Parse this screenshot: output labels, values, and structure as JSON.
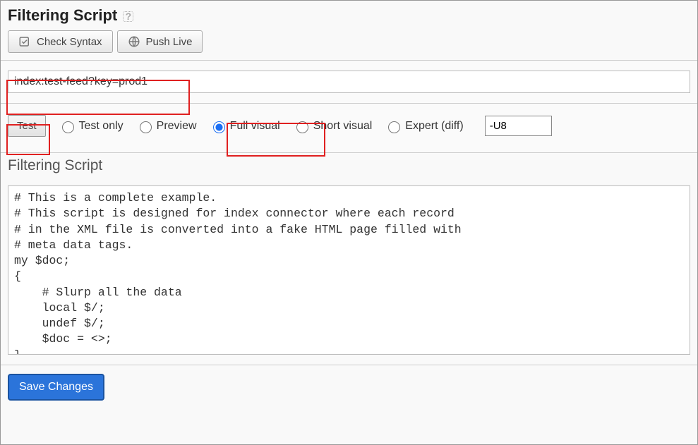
{
  "header": {
    "title": "Filtering Script",
    "check_syntax_label": "Check Syntax",
    "push_live_label": "Push Live"
  },
  "url_field": {
    "value": "index:test-feed?key=prod1"
  },
  "test_controls": {
    "test_button_label": "Test",
    "options": {
      "test_only": "Test only",
      "preview": "Preview",
      "full_visual": "Full visual",
      "short_visual": "Short visual",
      "expert_diff": "Expert (diff)"
    },
    "selected": "full_visual",
    "diff_value": "-U8"
  },
  "editor": {
    "heading": "Filtering Script",
    "content": "# This is a complete example.\n# This script is designed for index connector where each record\n# in the XML file is converted into a fake HTML page filled with\n# meta data tags.\nmy $doc;\n{\n    # Slurp all the data\n    local $/;\n    undef $/;\n    $doc = <>;\n}"
  },
  "footer": {
    "save_label": "Save Changes"
  }
}
